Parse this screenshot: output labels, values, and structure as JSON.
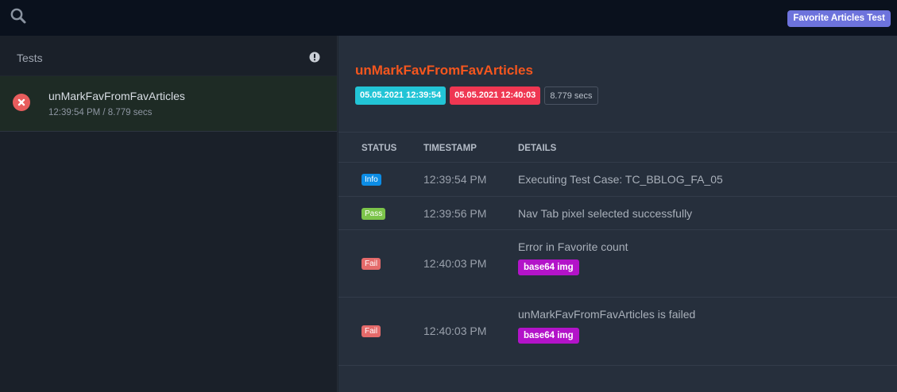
{
  "header": {
    "suite_badge": "Favorite Articles Test",
    "search_icon": "search-icon"
  },
  "sidebar": {
    "title": "Tests",
    "warning_icon": "exclamation-circle-icon",
    "items": [
      {
        "name": "unMarkFavFromFavArticles",
        "meta": "12:39:54 PM / 8.779 secs",
        "status": "fail",
        "status_icon": "fail-circle-icon"
      }
    ]
  },
  "detail": {
    "title": "unMarkFavFromFavArticles",
    "start_time": "05.05.2021 12:39:54",
    "end_time": "05.05.2021 12:40:03",
    "duration": "8.779 secs",
    "columns": [
      "STATUS",
      "TIMESTAMP",
      "DETAILS"
    ],
    "logs": [
      {
        "status": "Info",
        "timestamp": "12:39:54 PM",
        "details": "Executing Test Case: TC_BBLOG_FA_05"
      },
      {
        "status": "Pass",
        "timestamp": "12:39:56 PM",
        "details": "Nav Tab pixel selected successfully"
      },
      {
        "status": "Fail",
        "timestamp": "12:40:03 PM",
        "details": "Error in Favorite count",
        "attachment": "base64 img"
      },
      {
        "status": "Fail",
        "timestamp": "12:40:03 PM",
        "details": "unMarkFavFromFavArticles is failed",
        "attachment": "base64 img"
      }
    ]
  },
  "colors": {
    "accent_title": "#f5561e",
    "suite_badge": "#6d73dc",
    "start_badge": "#22c4d6",
    "end_badge": "#ef3752",
    "info": "#0c8de6",
    "pass": "#7cc44a",
    "fail": "#e46a6a",
    "attachment": "#b313c9"
  }
}
